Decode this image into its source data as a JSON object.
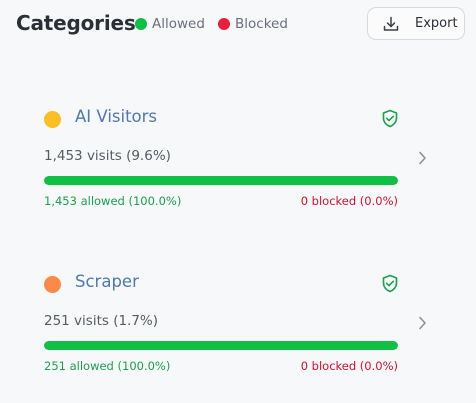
{
  "header": {
    "title": "Categories",
    "legend": {
      "allowed_label": "Allowed",
      "blocked_label": "Blocked",
      "allowed_color": "#0fc044",
      "blocked_color": "#e8203c"
    },
    "export_label": "Export",
    "export_icon": "download-icon"
  },
  "categories": [
    {
      "name": "AI Visitors",
      "dot_color": "#fbbe25",
      "visits": "1,453 visits (9.6%)",
      "allowed_fraction": 1.0,
      "allowed": "1,453 allowed (100.0%)",
      "blocked": "0 blocked (0.0%)",
      "status_icon": "shield-check-icon"
    },
    {
      "name": "Scraper",
      "dot_color": "#fb8a45",
      "visits": "251 visits (1.7%)",
      "allowed_fraction": 1.0,
      "allowed": "251 allowed (100.0%)",
      "blocked": "0 blocked (0.0%)",
      "status_icon": "shield-check-icon"
    }
  ]
}
